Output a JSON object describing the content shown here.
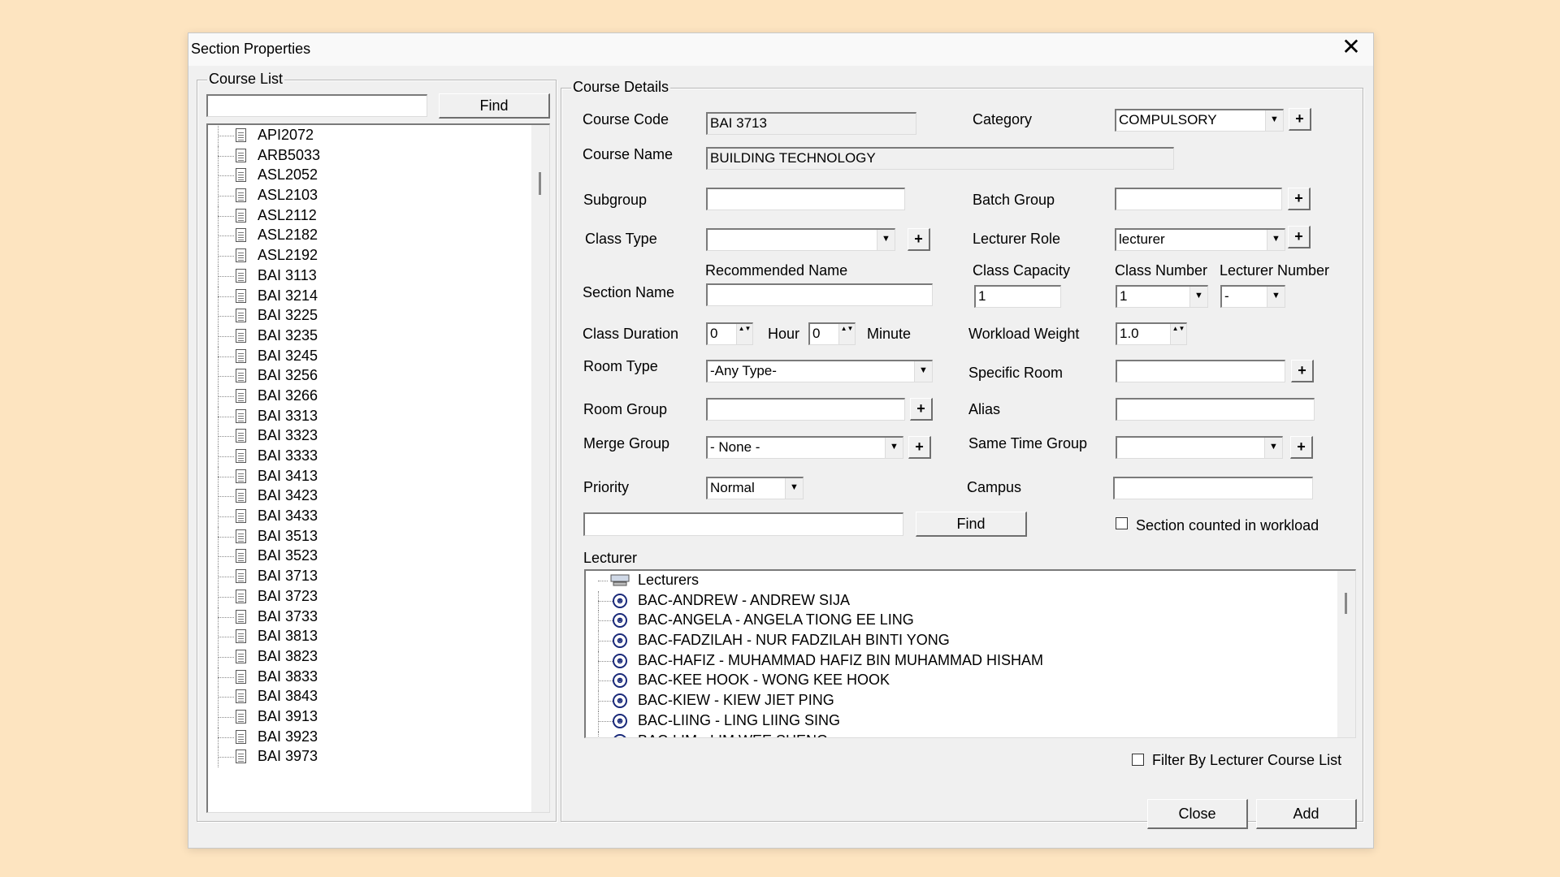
{
  "window": {
    "title": "Section Properties",
    "close_glyph": "✕"
  },
  "course_list": {
    "legend": "Course List",
    "search_value": "",
    "find_label": "Find",
    "items": [
      "API2072",
      "ARB5033",
      "ASL2052",
      "ASL2103",
      "ASL2112",
      "ASL2182",
      "ASL2192",
      "BAI 3113",
      "BAI 3214",
      "BAI 3225",
      "BAI 3235",
      "BAI 3245",
      "BAI 3256",
      "BAI 3266",
      "BAI 3313",
      "BAI 3323",
      "BAI 3333",
      "BAI 3413",
      "BAI 3423",
      "BAI 3433",
      "BAI 3513",
      "BAI 3523",
      "BAI 3713",
      "BAI 3723",
      "BAI 3733",
      "BAI 3813",
      "BAI 3823",
      "BAI 3833",
      "BAI 3843",
      "BAI 3913",
      "BAI 3923",
      "BAI 3973"
    ]
  },
  "details": {
    "legend": "Course Details",
    "course_code_label": "Course Code",
    "course_code": "BAI 3713",
    "category_label": "Category",
    "category": "COMPULSORY",
    "course_name_label": "Course Name",
    "course_name": "BUILDING TECHNOLOGY",
    "subgroup_label": "Subgroup",
    "subgroup": "",
    "batch_group_label": "Batch Group",
    "batch_group": "",
    "class_type_label": "Class Type",
    "class_type": "",
    "lecturer_role_label": "Lecturer Role",
    "lecturer_role": "lecturer",
    "recommended_name_label": "Recommended Name",
    "class_capacity_label": "Class Capacity",
    "class_capacity": "1",
    "class_number_label": "Class Number",
    "class_number": "1",
    "lecturer_number_label": "Lecturer Number",
    "lecturer_number": "-",
    "section_name_label": "Section Name",
    "section_name": "",
    "class_duration_label": "Class Duration",
    "duration_hour": "0",
    "hour_label": "Hour",
    "duration_minute": "0",
    "minute_label": "Minute",
    "workload_weight_label": "Workload Weight",
    "workload_weight": "1.0",
    "room_type_label": "Room Type",
    "room_type": "-Any Type-",
    "specific_room_label": "Specific Room",
    "specific_room": "",
    "room_group_label": "Room Group",
    "room_group": "",
    "alias_label": "Alias",
    "alias": "",
    "merge_group_label": "Merge Group",
    "merge_group": "- None -",
    "same_time_group_label": "Same Time Group",
    "same_time_group": "",
    "priority_label": "Priority",
    "priority": "Normal",
    "campus_label": "Campus",
    "campus": "",
    "lecturer_search": "",
    "find_label": "Find",
    "section_counted_label": "Section counted in workload",
    "section_counted": false,
    "plus": "+",
    "dropdown_glyph": "▼",
    "spin_glyph": "▲▼"
  },
  "lecturer": {
    "label": "Lecturer",
    "root": "Lecturers",
    "items": [
      "BAC-ANDREW - ANDREW SIJA",
      "BAC-ANGELA - ANGELA TIONG EE LING",
      "BAC-FADZILAH - NUR FADZILAH BINTI YONG",
      "BAC-HAFIZ - MUHAMMAD HAFIZ BIN MUHAMMAD HISHAM",
      "BAC-KEE HOOK - WONG KEE HOOK",
      "BAC-KIEW - KIEW JIET PING",
      "BAC-LIING - LING LIING SING",
      "BAC-LIM - LIM WEE SHENG"
    ],
    "filter_label": "Filter By Lecturer Course List",
    "filter_checked": false
  },
  "footer": {
    "close_label": "Close",
    "add_label": "Add"
  }
}
